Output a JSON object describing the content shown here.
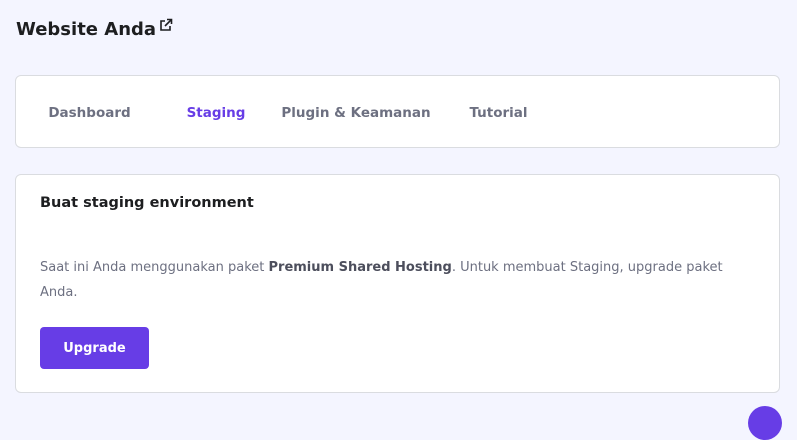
{
  "header": {
    "title": "Website Anda",
    "external_icon": "external-link-icon"
  },
  "tabs": [
    {
      "label": "Dashboard",
      "active": false
    },
    {
      "label": "Staging",
      "active": true
    },
    {
      "label": "Plugin & Keamanan",
      "active": false
    },
    {
      "label": "Tutorial",
      "active": false
    }
  ],
  "staging_card": {
    "title": "Buat staging environment",
    "description_before": "Saat ini Anda menggunakan paket ",
    "description_plan": "Premium Shared Hosting",
    "description_after": ". Untuk membuat Staging, upgrade paket Anda.",
    "button_label": "Upgrade"
  },
  "colors": {
    "accent": "#673de6",
    "background": "#f4f5ff",
    "card": "#ffffff",
    "muted_text": "#6d7081"
  }
}
